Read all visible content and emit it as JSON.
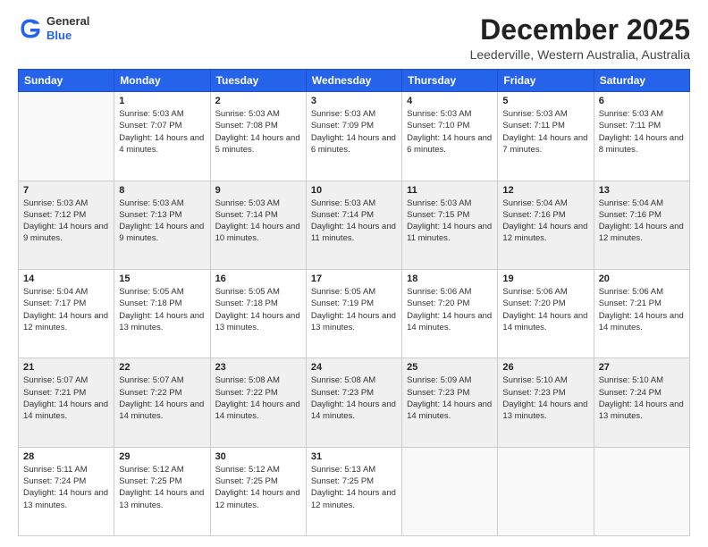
{
  "header": {
    "logo_general": "General",
    "logo_blue": "Blue",
    "month_title": "December 2025",
    "location": "Leederville, Western Australia, Australia"
  },
  "days_of_week": [
    "Sunday",
    "Monday",
    "Tuesday",
    "Wednesday",
    "Thursday",
    "Friday",
    "Saturday"
  ],
  "weeks": [
    [
      {
        "day": "",
        "sunrise": "",
        "sunset": "",
        "daylight": ""
      },
      {
        "day": "1",
        "sunrise": "Sunrise: 5:03 AM",
        "sunset": "Sunset: 7:07 PM",
        "daylight": "Daylight: 14 hours and 4 minutes."
      },
      {
        "day": "2",
        "sunrise": "Sunrise: 5:03 AM",
        "sunset": "Sunset: 7:08 PM",
        "daylight": "Daylight: 14 hours and 5 minutes."
      },
      {
        "day": "3",
        "sunrise": "Sunrise: 5:03 AM",
        "sunset": "Sunset: 7:09 PM",
        "daylight": "Daylight: 14 hours and 6 minutes."
      },
      {
        "day": "4",
        "sunrise": "Sunrise: 5:03 AM",
        "sunset": "Sunset: 7:10 PM",
        "daylight": "Daylight: 14 hours and 6 minutes."
      },
      {
        "day": "5",
        "sunrise": "Sunrise: 5:03 AM",
        "sunset": "Sunset: 7:11 PM",
        "daylight": "Daylight: 14 hours and 7 minutes."
      },
      {
        "day": "6",
        "sunrise": "Sunrise: 5:03 AM",
        "sunset": "Sunset: 7:11 PM",
        "daylight": "Daylight: 14 hours and 8 minutes."
      }
    ],
    [
      {
        "day": "7",
        "sunrise": "Sunrise: 5:03 AM",
        "sunset": "Sunset: 7:12 PM",
        "daylight": "Daylight: 14 hours and 9 minutes."
      },
      {
        "day": "8",
        "sunrise": "Sunrise: 5:03 AM",
        "sunset": "Sunset: 7:13 PM",
        "daylight": "Daylight: 14 hours and 9 minutes."
      },
      {
        "day": "9",
        "sunrise": "Sunrise: 5:03 AM",
        "sunset": "Sunset: 7:14 PM",
        "daylight": "Daylight: 14 hours and 10 minutes."
      },
      {
        "day": "10",
        "sunrise": "Sunrise: 5:03 AM",
        "sunset": "Sunset: 7:14 PM",
        "daylight": "Daylight: 14 hours and 11 minutes."
      },
      {
        "day": "11",
        "sunrise": "Sunrise: 5:03 AM",
        "sunset": "Sunset: 7:15 PM",
        "daylight": "Daylight: 14 hours and 11 minutes."
      },
      {
        "day": "12",
        "sunrise": "Sunrise: 5:04 AM",
        "sunset": "Sunset: 7:16 PM",
        "daylight": "Daylight: 14 hours and 12 minutes."
      },
      {
        "day": "13",
        "sunrise": "Sunrise: 5:04 AM",
        "sunset": "Sunset: 7:16 PM",
        "daylight": "Daylight: 14 hours and 12 minutes."
      }
    ],
    [
      {
        "day": "14",
        "sunrise": "Sunrise: 5:04 AM",
        "sunset": "Sunset: 7:17 PM",
        "daylight": "Daylight: 14 hours and 12 minutes."
      },
      {
        "day": "15",
        "sunrise": "Sunrise: 5:05 AM",
        "sunset": "Sunset: 7:18 PM",
        "daylight": "Daylight: 14 hours and 13 minutes."
      },
      {
        "day": "16",
        "sunrise": "Sunrise: 5:05 AM",
        "sunset": "Sunset: 7:18 PM",
        "daylight": "Daylight: 14 hours and 13 minutes."
      },
      {
        "day": "17",
        "sunrise": "Sunrise: 5:05 AM",
        "sunset": "Sunset: 7:19 PM",
        "daylight": "Daylight: 14 hours and 13 minutes."
      },
      {
        "day": "18",
        "sunrise": "Sunrise: 5:06 AM",
        "sunset": "Sunset: 7:20 PM",
        "daylight": "Daylight: 14 hours and 14 minutes."
      },
      {
        "day": "19",
        "sunrise": "Sunrise: 5:06 AM",
        "sunset": "Sunset: 7:20 PM",
        "daylight": "Daylight: 14 hours and 14 minutes."
      },
      {
        "day": "20",
        "sunrise": "Sunrise: 5:06 AM",
        "sunset": "Sunset: 7:21 PM",
        "daylight": "Daylight: 14 hours and 14 minutes."
      }
    ],
    [
      {
        "day": "21",
        "sunrise": "Sunrise: 5:07 AM",
        "sunset": "Sunset: 7:21 PM",
        "daylight": "Daylight: 14 hours and 14 minutes."
      },
      {
        "day": "22",
        "sunrise": "Sunrise: 5:07 AM",
        "sunset": "Sunset: 7:22 PM",
        "daylight": "Daylight: 14 hours and 14 minutes."
      },
      {
        "day": "23",
        "sunrise": "Sunrise: 5:08 AM",
        "sunset": "Sunset: 7:22 PM",
        "daylight": "Daylight: 14 hours and 14 minutes."
      },
      {
        "day": "24",
        "sunrise": "Sunrise: 5:08 AM",
        "sunset": "Sunset: 7:23 PM",
        "daylight": "Daylight: 14 hours and 14 minutes."
      },
      {
        "day": "25",
        "sunrise": "Sunrise: 5:09 AM",
        "sunset": "Sunset: 7:23 PM",
        "daylight": "Daylight: 14 hours and 14 minutes."
      },
      {
        "day": "26",
        "sunrise": "Sunrise: 5:10 AM",
        "sunset": "Sunset: 7:23 PM",
        "daylight": "Daylight: 14 hours and 13 minutes."
      },
      {
        "day": "27",
        "sunrise": "Sunrise: 5:10 AM",
        "sunset": "Sunset: 7:24 PM",
        "daylight": "Daylight: 14 hours and 13 minutes."
      }
    ],
    [
      {
        "day": "28",
        "sunrise": "Sunrise: 5:11 AM",
        "sunset": "Sunset: 7:24 PM",
        "daylight": "Daylight: 14 hours and 13 minutes."
      },
      {
        "day": "29",
        "sunrise": "Sunrise: 5:12 AM",
        "sunset": "Sunset: 7:25 PM",
        "daylight": "Daylight: 14 hours and 13 minutes."
      },
      {
        "day": "30",
        "sunrise": "Sunrise: 5:12 AM",
        "sunset": "Sunset: 7:25 PM",
        "daylight": "Daylight: 14 hours and 12 minutes."
      },
      {
        "day": "31",
        "sunrise": "Sunrise: 5:13 AM",
        "sunset": "Sunset: 7:25 PM",
        "daylight": "Daylight: 14 hours and 12 minutes."
      },
      {
        "day": "",
        "sunrise": "",
        "sunset": "",
        "daylight": ""
      },
      {
        "day": "",
        "sunrise": "",
        "sunset": "",
        "daylight": ""
      },
      {
        "day": "",
        "sunrise": "",
        "sunset": "",
        "daylight": ""
      }
    ]
  ]
}
